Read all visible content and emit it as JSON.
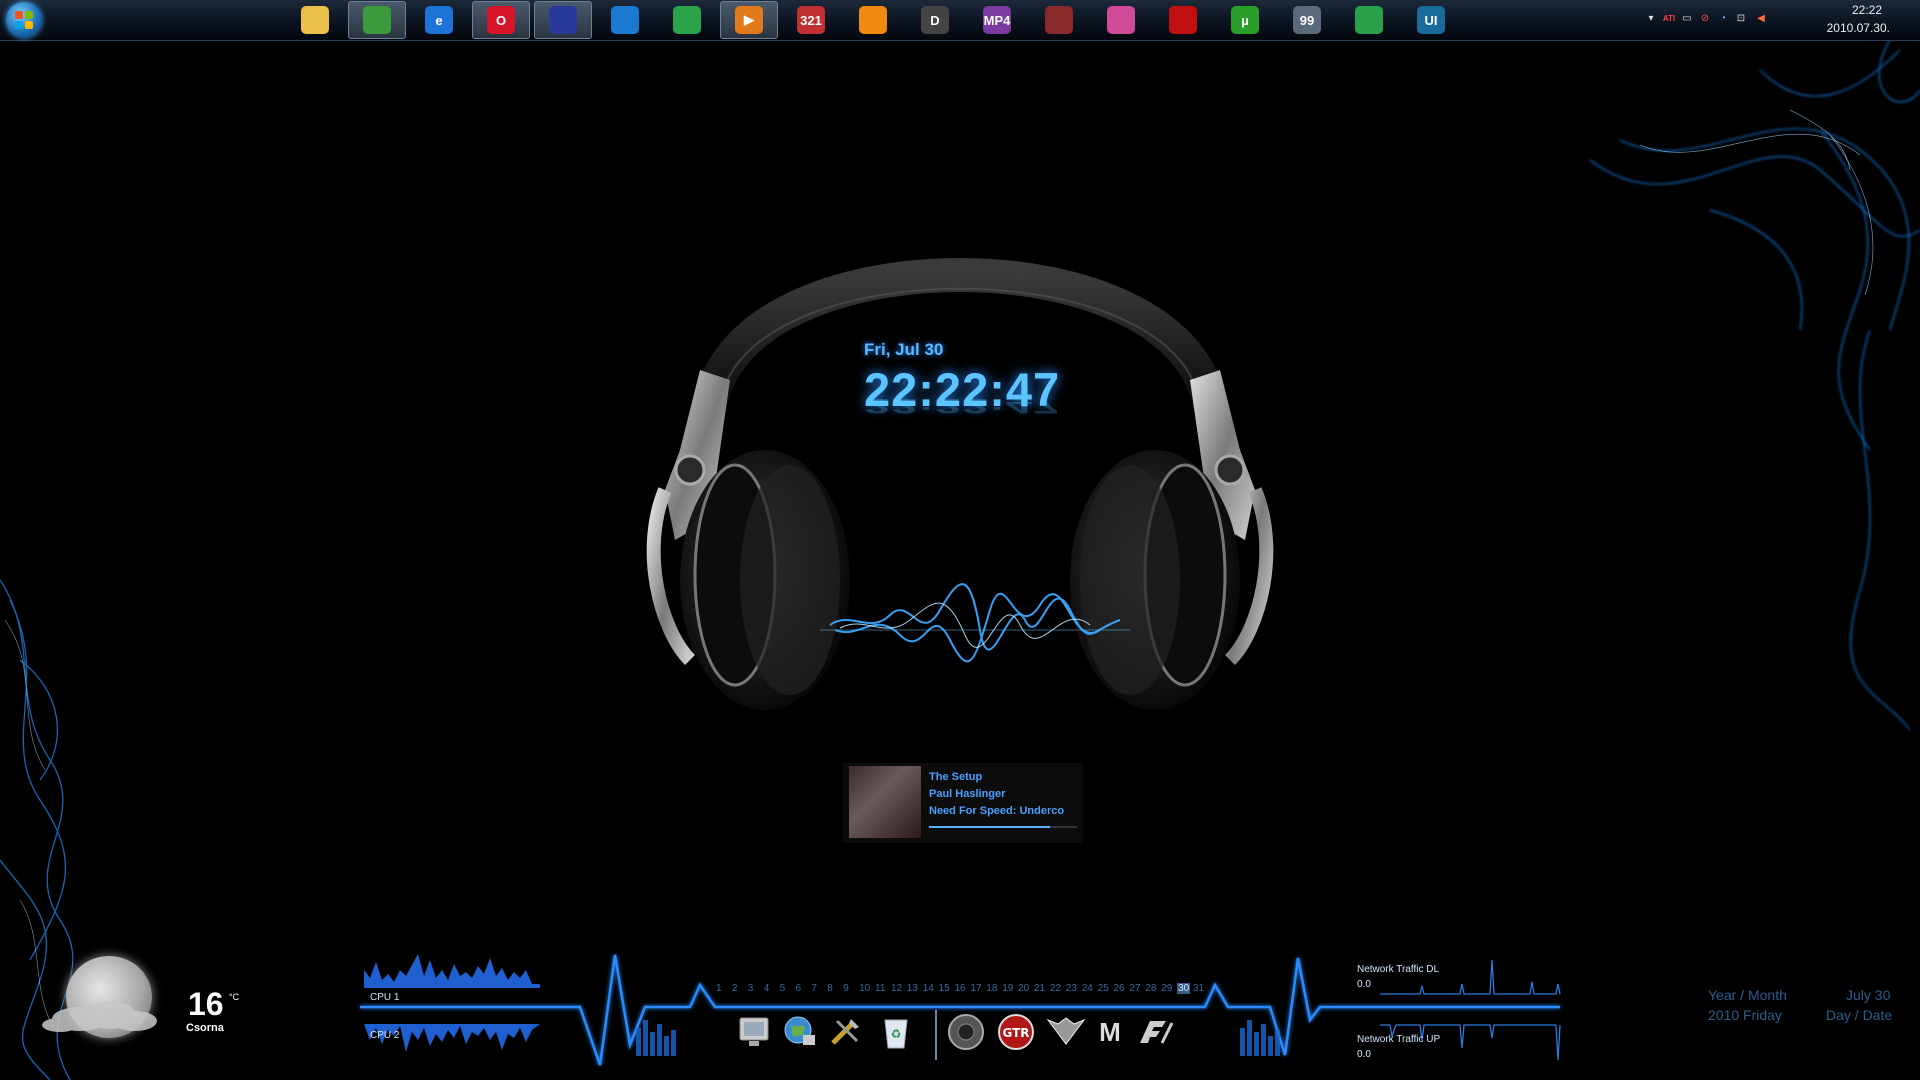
{
  "taskbar": {
    "apps": [
      {
        "icon": "folder-icon",
        "label": "",
        "color": "#e8c04a",
        "active": false
      },
      {
        "icon": "messenger-icon",
        "label": "",
        "color": "#3b9a3b",
        "active": true
      },
      {
        "icon": "internet-explorer-icon",
        "label": "e",
        "color": "#1e73d9",
        "active": false
      },
      {
        "icon": "opera-icon",
        "label": "O",
        "color": "#d8142a",
        "active": true
      },
      {
        "icon": "floppy-save-icon",
        "label": "",
        "color": "#2a3a9a",
        "active": true
      },
      {
        "icon": "media-center-icon",
        "label": "",
        "color": "#1a7ad0",
        "active": false
      },
      {
        "icon": "windows-icon",
        "label": "",
        "color": "#2aa34a",
        "active": false
      },
      {
        "icon": "media-player-icon",
        "label": "▶",
        "color": "#e07a1a",
        "active": true
      },
      {
        "icon": "media-player-classic-icon",
        "label": "321",
        "color": "#c03030",
        "active": false
      },
      {
        "icon": "vlc-cone-icon",
        "label": "",
        "color": "#f08a10",
        "active": false
      },
      {
        "icon": "dscaler-icon",
        "label": "D",
        "color": "#444444",
        "active": false
      },
      {
        "icon": "mp4-icon",
        "label": "MP4",
        "color": "#7a3aa0",
        "active": false
      },
      {
        "icon": "game-icon",
        "label": "",
        "color": "#8a2a2a",
        "active": false
      },
      {
        "icon": "picasa-icon",
        "label": "",
        "color": "#d04a9a",
        "active": false
      },
      {
        "icon": "acrobat-icon",
        "label": "",
        "color": "#c01010",
        "active": false
      },
      {
        "icon": "utorrent-icon",
        "label": "µ",
        "color": "#2aa02a",
        "active": false
      },
      {
        "icon": "shield-99-icon",
        "label": "99",
        "color": "#5a6a7a",
        "active": false
      },
      {
        "icon": "green-app-icon",
        "label": "",
        "color": "#2aa04a",
        "active": false
      },
      {
        "icon": "ui-tiles-icon",
        "label": "UI",
        "color": "#1a6a9a",
        "active": false
      }
    ],
    "tray": {
      "icons": [
        "show-hidden-arrow-icon",
        "ati-icon",
        "monitor-icon",
        "antivirus-icon",
        "network-icon",
        "safely-remove-icon",
        "volume-icon"
      ],
      "ati_label": "ATI",
      "time": "22:22",
      "date": "2010.07.30."
    }
  },
  "clock": {
    "date": "Fri, Jul 30",
    "time": "22:22:47"
  },
  "now_playing": {
    "title": "The Setup",
    "artist": "Paul Haslinger",
    "album": "Need For Speed: Underco",
    "progress": 0.82
  },
  "weather": {
    "temperature": "16",
    "unit": "°C",
    "city": "Csorna"
  },
  "cpu": {
    "cpu1_label": "CPU 1",
    "cpu2_label": "CPU 2"
  },
  "calendar_strip": {
    "days": [
      "1",
      "2",
      "3",
      "4",
      "5",
      "6",
      "7",
      "8",
      "9",
      "10",
      "11",
      "12",
      "13",
      "14",
      "15",
      "16",
      "17",
      "18",
      "19",
      "20",
      "21",
      "22",
      "23",
      "24",
      "25",
      "26",
      "27",
      "28",
      "29",
      "30",
      "31"
    ],
    "today": "30"
  },
  "dock": {
    "icons": [
      "computer-icon",
      "network-globe-icon",
      "tools-icon",
      "recycle-bin-icon",
      "game-disc-icon",
      "gtr-icon",
      "winged-emblem-icon",
      "m-logo-icon",
      "need-for-speed-icon"
    ],
    "m_label": "M"
  },
  "network": {
    "dl_label": "Network Traffic DL",
    "dl_value": "0.0",
    "up_label": "Network Traffic UP",
    "up_value": "0.0"
  },
  "right_calendar": {
    "line1_left": "Year / Month",
    "line1_right": "July 30",
    "line2_left": "2010 Friday",
    "line2_right": "Day / Date"
  },
  "colors": {
    "accent": "#2a8bff",
    "glow": "#5cc4ff"
  }
}
